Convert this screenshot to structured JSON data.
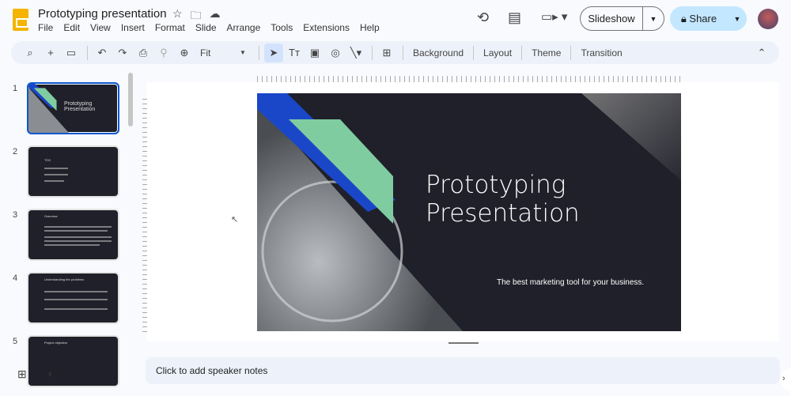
{
  "app": {
    "title": "Prototyping presentation",
    "menu": [
      "File",
      "Edit",
      "View",
      "Insert",
      "Format",
      "Slide",
      "Arrange",
      "Tools",
      "Extensions",
      "Help"
    ]
  },
  "header": {
    "slideshow_label": "Slideshow",
    "share_label": "Share"
  },
  "toolbar": {
    "zoom_value": "Fit",
    "background": "Background",
    "layout": "Layout",
    "theme": "Theme",
    "transition": "Transition"
  },
  "filmstrip": {
    "slides": [
      {
        "number": "1",
        "title": "Prototyping Presentation"
      },
      {
        "number": "2",
        "title": "TOC"
      },
      {
        "number": "3",
        "title": "Overview"
      },
      {
        "number": "4",
        "title": "Understanding the problems"
      },
      {
        "number": "5",
        "title": "Project objective"
      }
    ]
  },
  "slide": {
    "title_line1": "Prototyping",
    "title_line2": "Presentation",
    "subtitle": "The best marketing tool for your business.",
    "colors": {
      "background": "#1f2029",
      "blue": "#1a47c8",
      "green": "#7fcca0"
    }
  },
  "notes": {
    "placeholder": "Click to add speaker notes"
  }
}
